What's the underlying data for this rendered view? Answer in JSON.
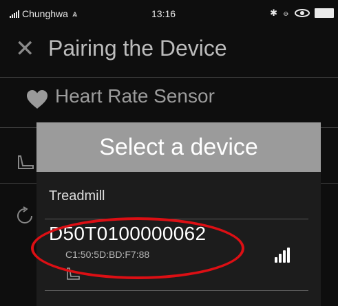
{
  "status_bar": {
    "carrier": "Chunghwa",
    "wifi_icon": "wifi-icon",
    "time": "13:16",
    "icons": [
      "bluetooth-icon",
      "alarm-icon",
      "eye-icon",
      "battery-icon"
    ]
  },
  "background": {
    "title": "Pairing the Device",
    "close_icon": "close-icon",
    "sensor_label": "Heart Rate Sensor",
    "sensor_icon": "heart-icon"
  },
  "dialog": {
    "title": "Select a device",
    "category": "Treadmill",
    "devices": [
      {
        "name": "D50T0100000062",
        "mac": "C1:50:5D:BD:F7:88",
        "signal_icon": "signal-strength-icon",
        "type_icon": "treadmill-icon"
      }
    ]
  },
  "annotation": {
    "highlight_color": "#dc0f14"
  }
}
